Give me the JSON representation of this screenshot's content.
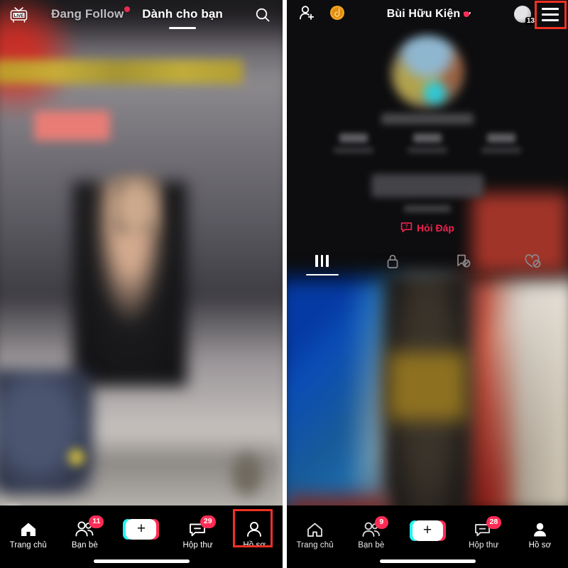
{
  "left_panel": {
    "name": "tiktok-feed-screen",
    "topbar": {
      "live_label": "LIVE",
      "tabs": [
        {
          "label": "Đang Follow",
          "active": false,
          "has_dot": true
        },
        {
          "label": "Dành cho bạn",
          "active": true,
          "has_dot": false
        }
      ],
      "search_icon": "search-icon"
    },
    "bottom_nav": {
      "items": [
        {
          "label": "Trang chủ",
          "icon": "home-icon",
          "badge": ""
        },
        {
          "label": "Bạn bè",
          "icon": "friends-icon",
          "badge": "11"
        },
        {
          "label": "",
          "icon": "create-plus-icon",
          "badge": ""
        },
        {
          "label": "Hộp thư",
          "icon": "inbox-icon",
          "badge": "29"
        },
        {
          "label": "Hồ sơ",
          "icon": "profile-icon",
          "badge": ""
        }
      ],
      "create_plus": "+",
      "highlighted_item": "Hồ sơ"
    }
  },
  "right_panel": {
    "name": "tiktok-profile-screen",
    "header": {
      "add_friend_icon": "add-person-icon",
      "coin_icon": "coin-icon",
      "username": "Bùi Hữu Kiện",
      "chevron": "chevron-down-icon",
      "has_notification_dot": true,
      "avatar_badge": "13",
      "menu_icon": "hamburger-menu-icon"
    },
    "qa": {
      "icon": "question-bubble-icon",
      "label": "Hỏi Đáp"
    },
    "profile_tabs": [
      {
        "icon": "grid-icon",
        "active": true
      },
      {
        "icon": "lock-icon",
        "active": false
      },
      {
        "icon": "bookmark-off-icon",
        "active": false
      },
      {
        "icon": "heart-off-icon",
        "active": false
      }
    ],
    "bottom_nav": {
      "items": [
        {
          "label": "Trang chủ",
          "icon": "home-icon",
          "badge": ""
        },
        {
          "label": "Bạn bè",
          "icon": "friends-icon",
          "badge": "9"
        },
        {
          "label": "",
          "icon": "create-plus-icon",
          "badge": ""
        },
        {
          "label": "Hộp thư",
          "icon": "inbox-icon",
          "badge": "28"
        },
        {
          "label": "Hồ sơ",
          "icon": "profile-icon",
          "badge": ""
        }
      ],
      "create_plus": "+",
      "active_item": "Hồ sơ"
    }
  },
  "colors": {
    "accent_red": "#fe2c55",
    "accent_cyan": "#25f4ee",
    "annotation_red": "#ee3124",
    "qa_red": "#f0224e",
    "coin_gold": "#f5a623"
  }
}
